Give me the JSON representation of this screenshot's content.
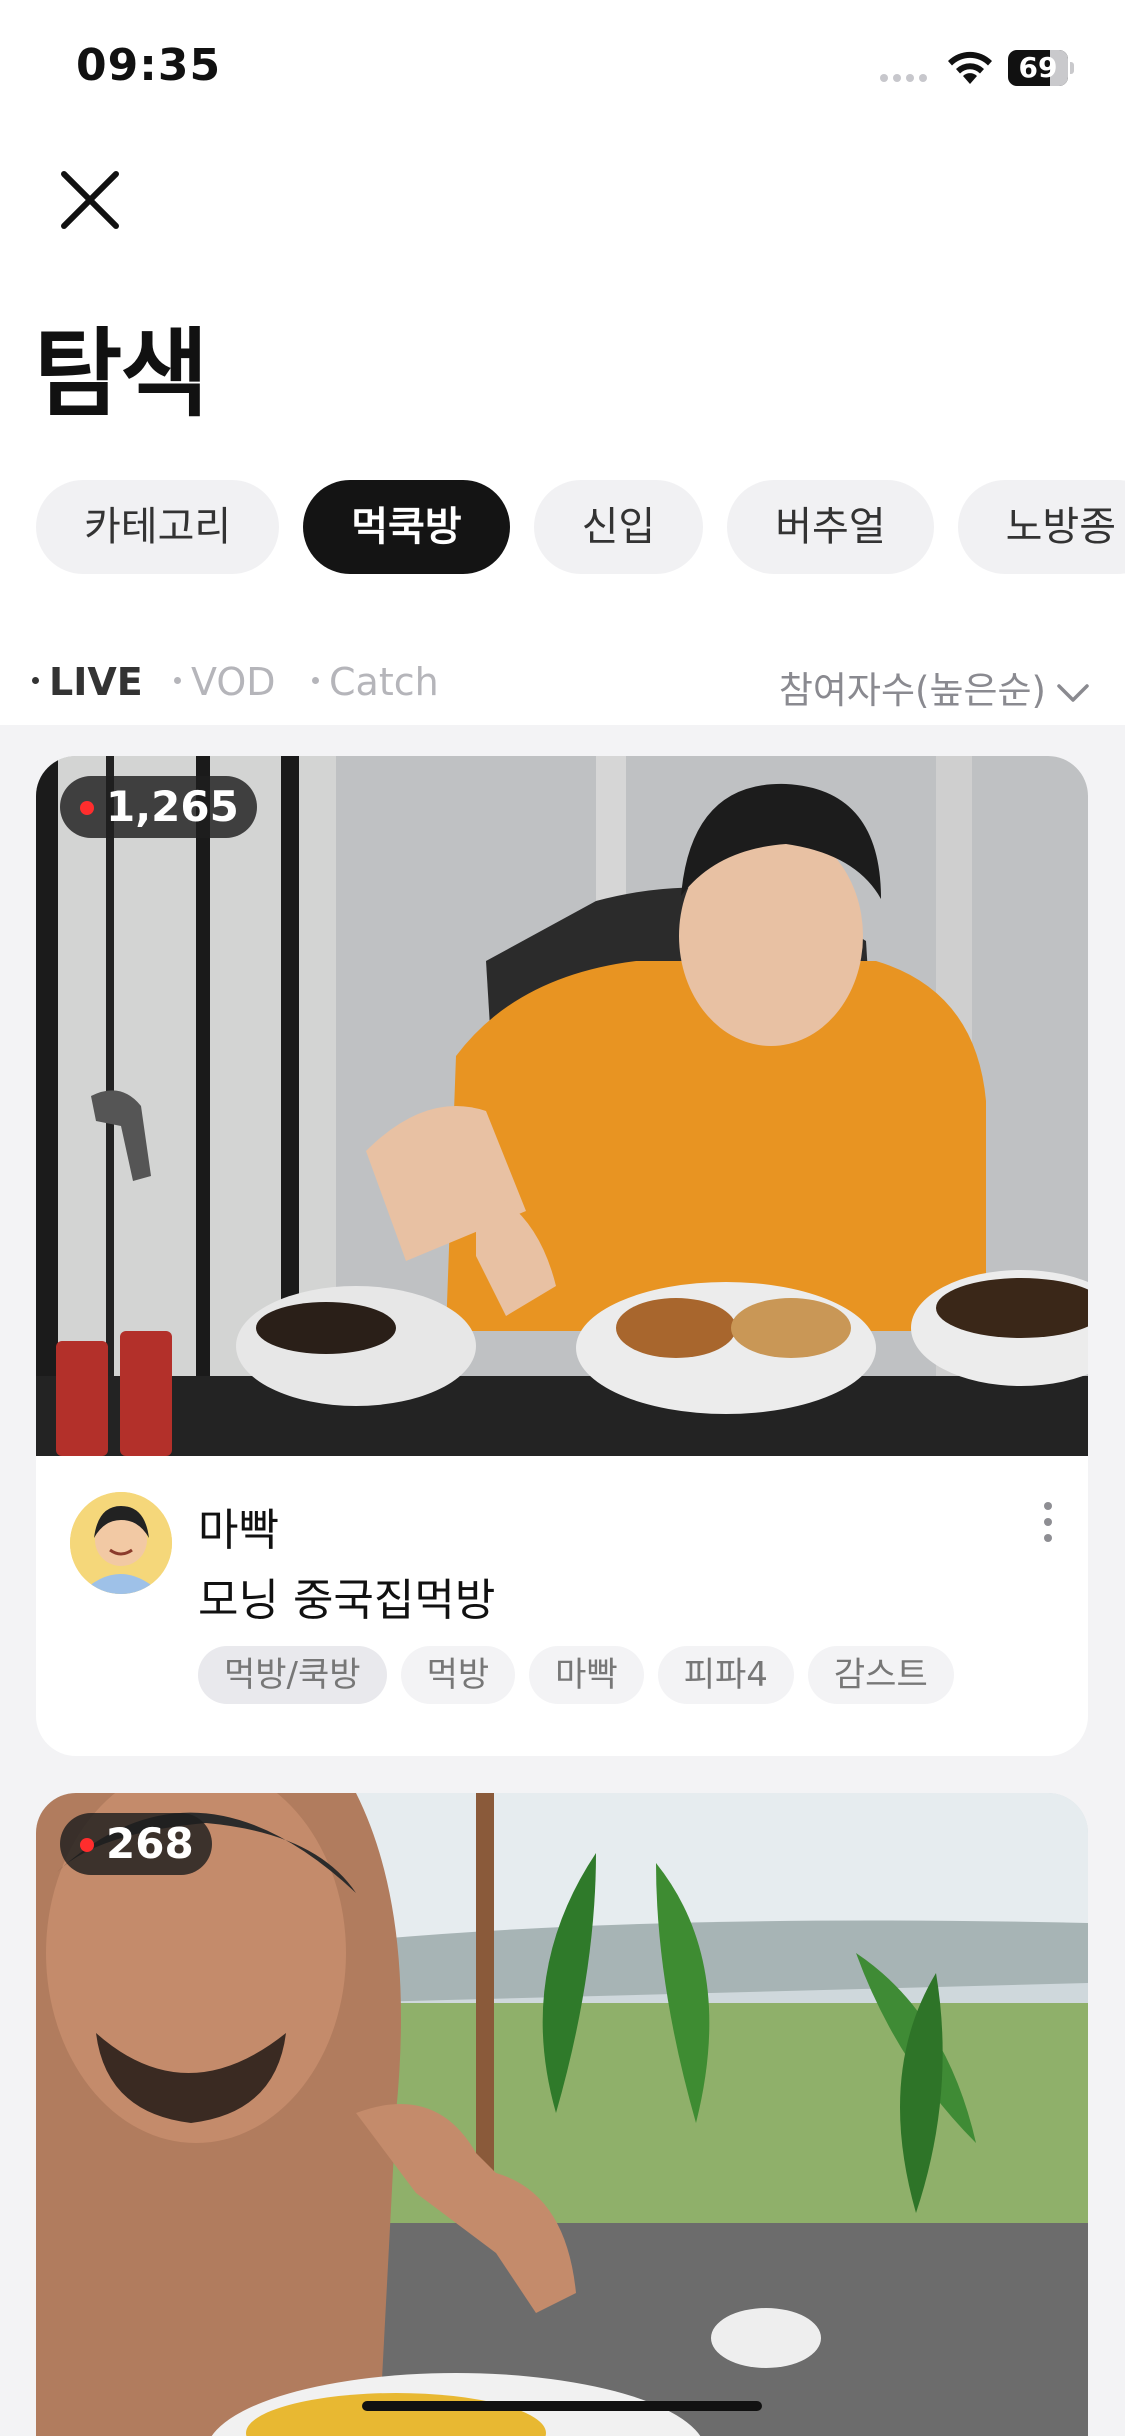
{
  "status_bar": {
    "time": "09:35",
    "battery": "69"
  },
  "page": {
    "title": "탐색"
  },
  "categories": [
    {
      "label": "카테고리",
      "active": false
    },
    {
      "label": "먹쿡방",
      "active": true
    },
    {
      "label": "신입",
      "active": false
    },
    {
      "label": "버추얼",
      "active": false
    },
    {
      "label": "노방종",
      "active": false
    }
  ],
  "filter": {
    "tabs": [
      {
        "label": "LIVE",
        "active": true
      },
      {
        "label": "VOD",
        "active": false
      },
      {
        "label": "Catch",
        "active": false
      }
    ],
    "sort_label": "참여자수(높은순)"
  },
  "cards": [
    {
      "viewers": "1,265",
      "streamer": "마빡",
      "title": "모닝 중국집먹방",
      "tags": [
        "먹방/쿡방",
        "먹방",
        "마빡",
        "피파4",
        "감스트"
      ]
    },
    {
      "viewers": "268"
    }
  ],
  "colors": {
    "accent_dark": "#141414",
    "live_dot": "#ff2d2d",
    "background": "#f3f3f5"
  }
}
